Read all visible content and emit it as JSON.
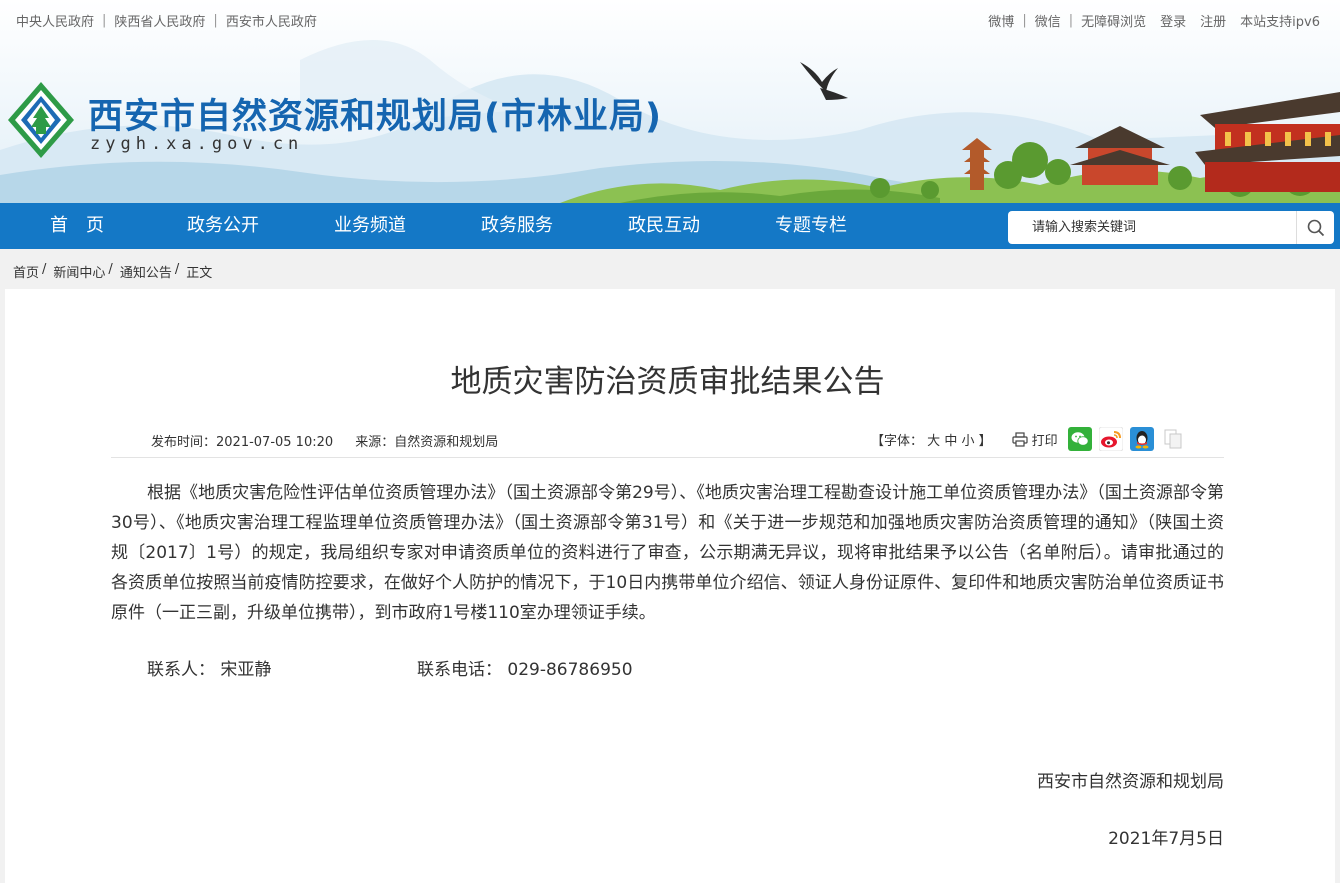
{
  "top_links_left": [
    "中央人民政府",
    "陕西省人民政府",
    "西安市人民政府"
  ],
  "top_links_right": {
    "social": [
      "微博",
      "微信"
    ],
    "others": [
      "无障碍浏览",
      "登录",
      "注册",
      "本站支持ipv6"
    ]
  },
  "site": {
    "title": "西安市自然资源和规划局(市林业局)",
    "domain": "zygh.xa.gov.cn"
  },
  "nav": {
    "items": [
      "首　页",
      "政务公开",
      "业务频道",
      "政务服务",
      "政民互动",
      "专题专栏"
    ],
    "search_placeholder": "请输入搜索关键词"
  },
  "breadcrumb": [
    "首页",
    "新闻中心",
    "通知公告",
    "正文"
  ],
  "article": {
    "title": "地质灾害防治资质审批结果公告",
    "publish_time": "发布时间：2021-07-05 10:20",
    "source": "来源：自然资源和规划局",
    "font_size_label": "【字体：",
    "font_sizes": [
      "大",
      "中",
      "小"
    ],
    "font_size_close": "】",
    "print_label": "打印",
    "body": "根据《地质灾害危险性评估单位资质管理办法》（国土资源部令第29号）、《地质灾害治理工程勘查设计施工单位资质管理办法》（国土资源部令第30号）、《地质灾害治理工程监理单位资质管理办法》（国土资源部令第31号）和《关于进一步规范和加强地质灾害防治资质管理的通知》（陕国土资规〔2017〕1号）的规定，我局组织专家对申请资质单位的资料进行了审查，公示期满无异议，现将审批结果予以公告（名单附后）。请审批通过的各资质单位按照当前疫情防控要求，在做好个人防护的情况下，于10日内携带单位介绍信、领证人身份证原件、复印件和地质灾害防治单位资质证书原件（一正三副，升级单位携带），到市政府1号楼110室办理领证手续。",
    "contact": "联系人：  宋亚静",
    "phone": "联系电话：  029-86786950",
    "signature_org": "西安市自然资源和规划局",
    "signature_date": "2021年7月5日"
  },
  "colors": {
    "nav_bg": "#1478c6",
    "title_blue": "#1565b0",
    "wechat_green": "#33b13a",
    "qq_blue": "#2a8fd6"
  },
  "icons": [
    "search-icon",
    "print-icon",
    "wechat-icon",
    "weibo-icon",
    "qq-icon",
    "copy-icon"
  ]
}
